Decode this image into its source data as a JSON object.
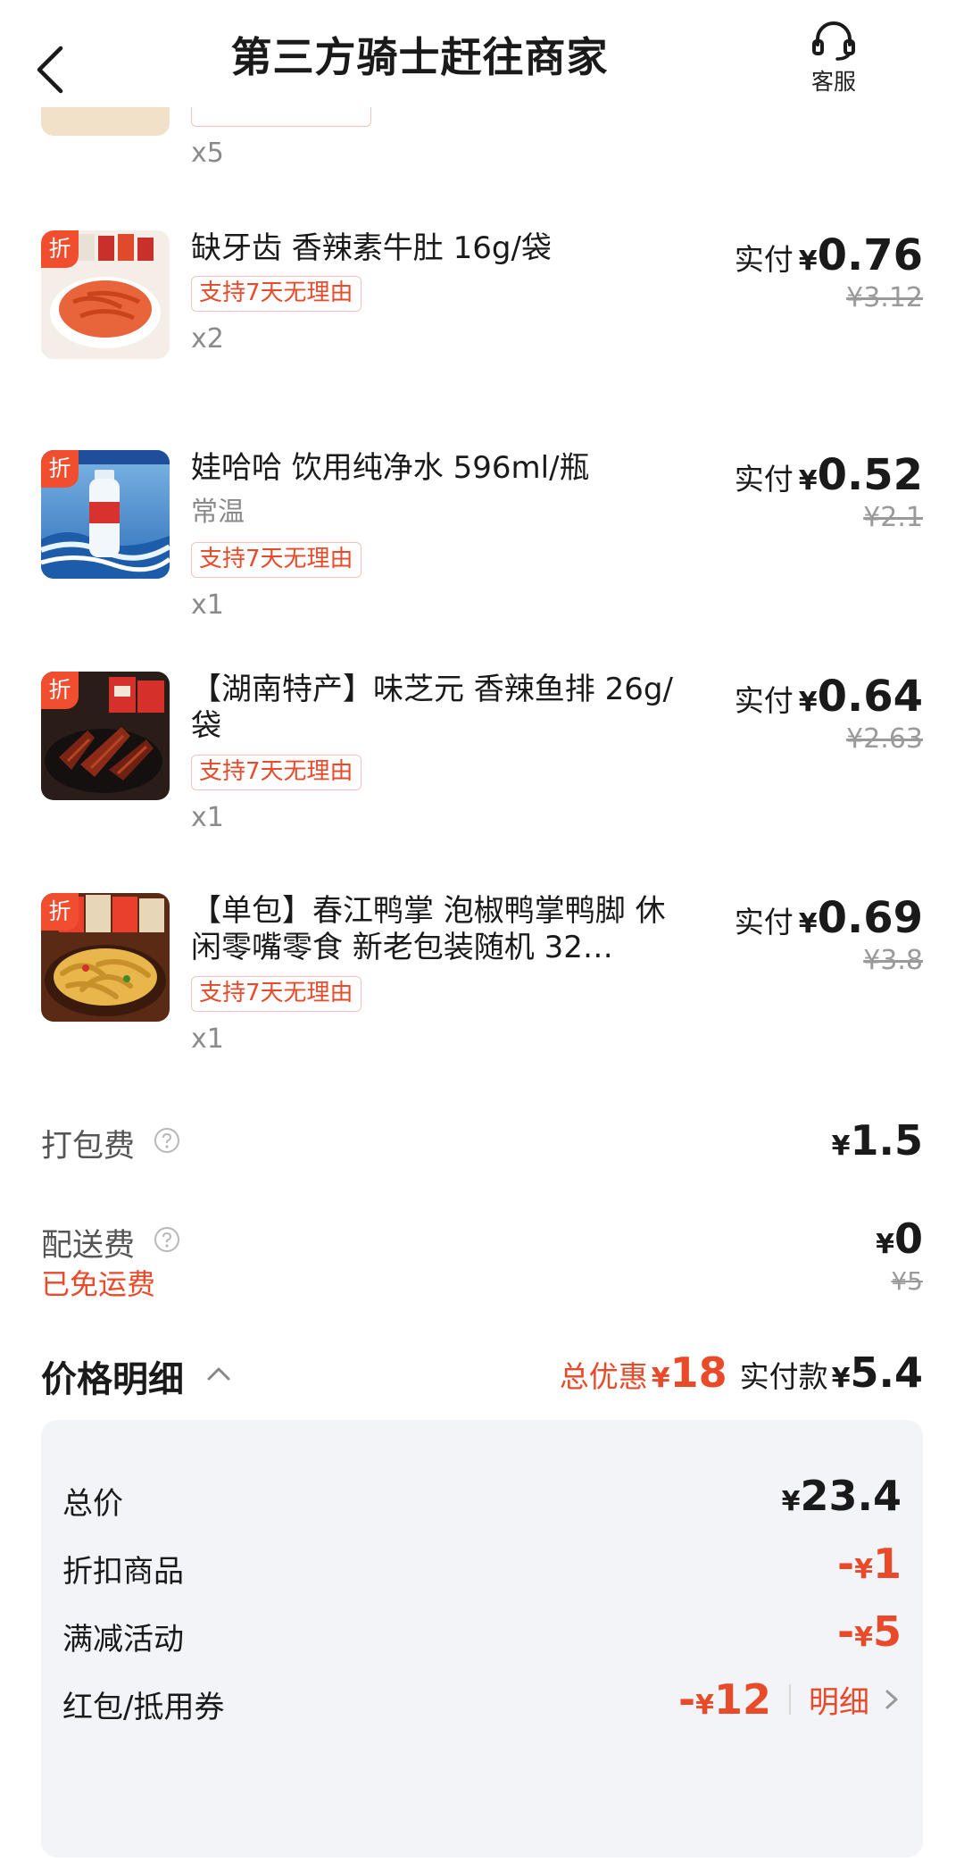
{
  "header": {
    "title": "第三方骑士赶往商家",
    "service_label": "客服"
  },
  "partial_item": {
    "qty": "x5"
  },
  "products": [
    {
      "badge": "折",
      "name": "缺牙齿 香辣素牛肚 16g/袋",
      "sub": "",
      "tag": "支持7天无理由",
      "qty": "x2",
      "paid_label": "实付",
      "currency": "¥",
      "paid": "0.76",
      "original": "¥3.12"
    },
    {
      "badge": "折",
      "name": "娃哈哈 饮用纯净水 596ml/瓶",
      "sub": "常温",
      "tag": "支持7天无理由",
      "qty": "x1",
      "paid_label": "实付",
      "currency": "¥",
      "paid": "0.52",
      "original": "¥2.1"
    },
    {
      "badge": "折",
      "name": "【湖南特产】味芝元 香辣鱼排 26g/袋",
      "sub": "",
      "tag": "支持7天无理由",
      "qty": "x1",
      "paid_label": "实付",
      "currency": "¥",
      "paid": "0.64",
      "original": "¥2.63"
    },
    {
      "badge": "折",
      "name": "【单包】春江鸭掌 泡椒鸭掌鸭脚 休闲零嘴零食 新老包装随机 32…",
      "sub": "",
      "tag": "支持7天无理由",
      "qty": "x1",
      "paid_label": "实付",
      "currency": "¥",
      "paid": "0.69",
      "original": "¥3.8"
    }
  ],
  "fees": {
    "packing_label": "打包费",
    "packing_currency": "¥",
    "packing_value": "1.5",
    "delivery_label": "配送费",
    "delivery_currency": "¥",
    "delivery_value": "0",
    "delivery_original": "¥5",
    "delivery_free": "已免运费"
  },
  "price_detail": {
    "heading": "价格明细",
    "total_discount_label": "总优惠",
    "total_discount_currency": "¥",
    "total_discount": "18",
    "actual_label": "实付款",
    "actual_currency": "¥",
    "actual": "5.4",
    "rows": [
      {
        "label": "总价",
        "sign": "",
        "currency": "¥",
        "value": "23.4"
      },
      {
        "label": "折扣商品",
        "sign": "-",
        "currency": "¥",
        "value": "1"
      },
      {
        "label": "满减活动",
        "sign": "-",
        "currency": "¥",
        "value": "5"
      },
      {
        "label": "红包/抵用券",
        "sign": "-",
        "currency": "¥",
        "value": "12"
      }
    ],
    "detail_link": "明细"
  },
  "colors": {
    "accent_red": "#e84a2a",
    "badge_orange": "#f04e2e",
    "panel_bg": "#f2f4f8"
  }
}
